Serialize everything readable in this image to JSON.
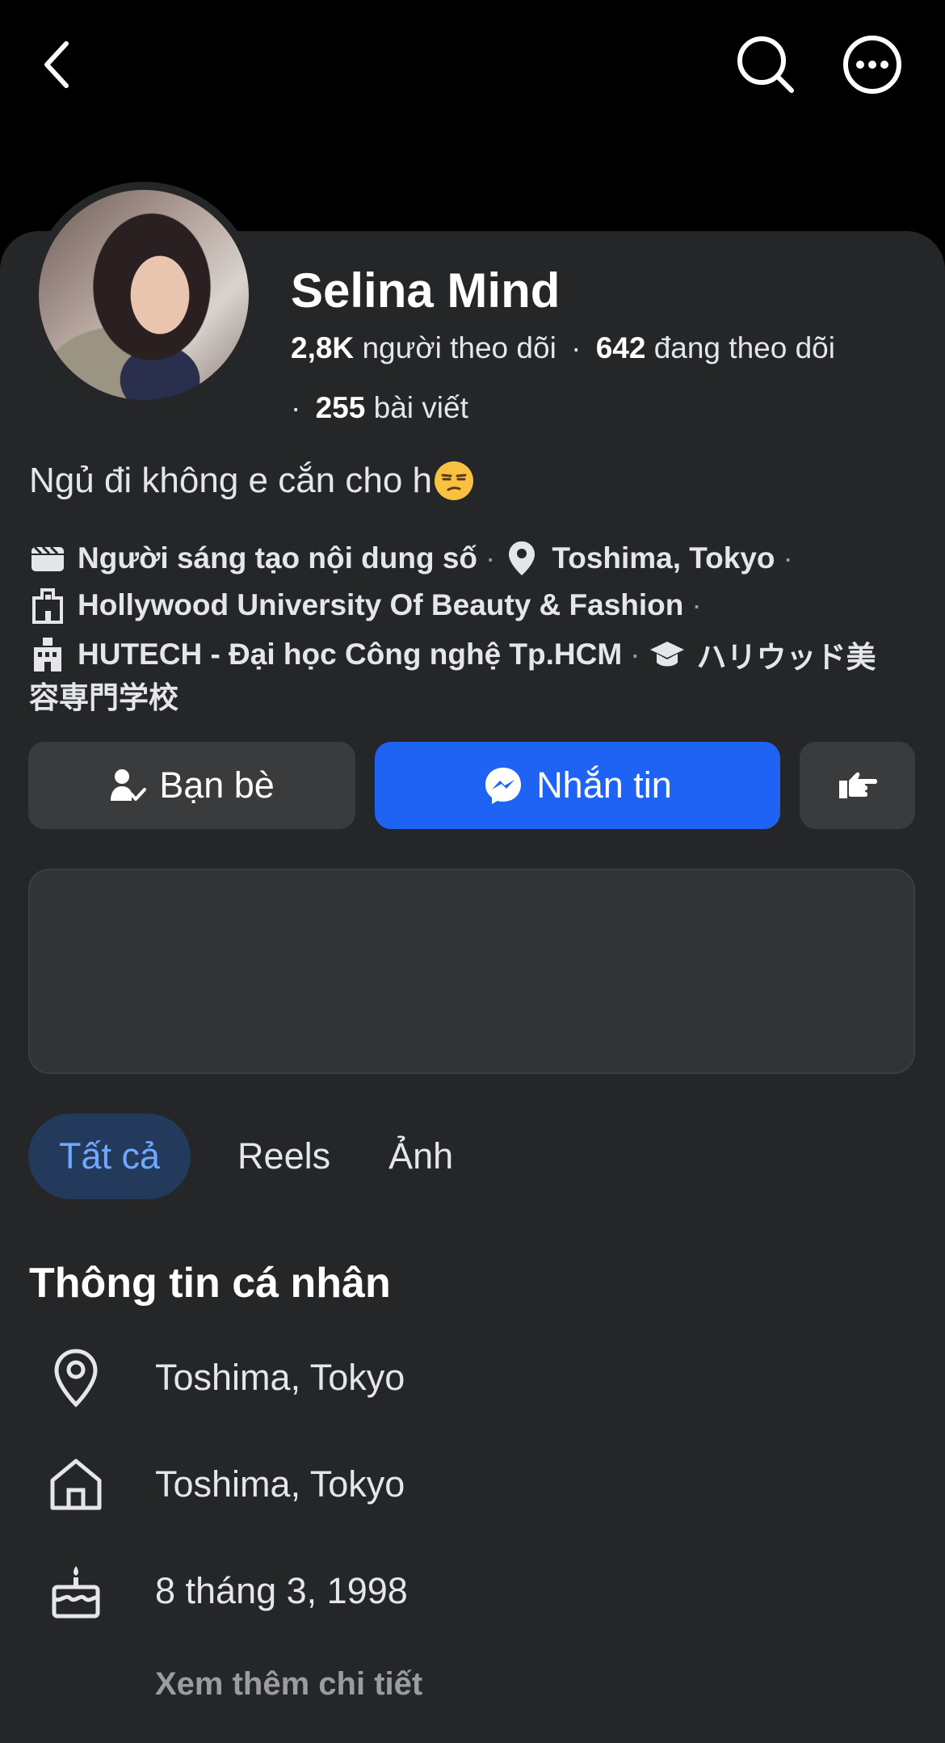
{
  "header": {
    "back_icon": "chevron-left-icon",
    "search_icon": "search-icon",
    "more_icon": "more-horizontal-icon"
  },
  "profile": {
    "name": "Selina Mind",
    "followers_count": "2,8K",
    "followers_label": "người theo dõi",
    "dot": "·",
    "following_count": "642",
    "following_label": "đang theo dõi",
    "posts_count": "255",
    "posts_label": "bài viết",
    "bio": "Ngủ đi không e cắn cho h",
    "bio_emoji": "unamused-face-emoji"
  },
  "intro": {
    "job": "Người sáng tạo nội dung số",
    "location": "Toshima, Tokyo",
    "school1": "Hollywood University Of Beauty & Fashion",
    "school2": "HUTECH - Đại học Công nghệ Tp.HCM",
    "school3_line1": "ハリウッド美",
    "school3_line2": "容専門学校",
    "separator": "·"
  },
  "actions": {
    "friends_label": "Bạn bè",
    "message_label": "Nhắn tin",
    "more_icon": "poke-hand-icon"
  },
  "tabs": [
    {
      "label": "Tất cả",
      "active": true
    },
    {
      "label": "Reels",
      "active": false
    },
    {
      "label": "Ảnh",
      "active": false
    }
  ],
  "details": {
    "title": "Thông tin cá nhân",
    "lives_in": "Toshima, Tokyo",
    "from": "Toshima, Tokyo",
    "birthday": "8 tháng 3, 1998",
    "see_more": "Xem thêm chi tiết"
  },
  "colors": {
    "background": "#000000",
    "sheet": "#252628",
    "primary_button": "#1e63f3",
    "secondary_button": "#3a3b3d",
    "active_tab_bg": "#233a5c",
    "active_tab_text": "#6ea8ff"
  }
}
